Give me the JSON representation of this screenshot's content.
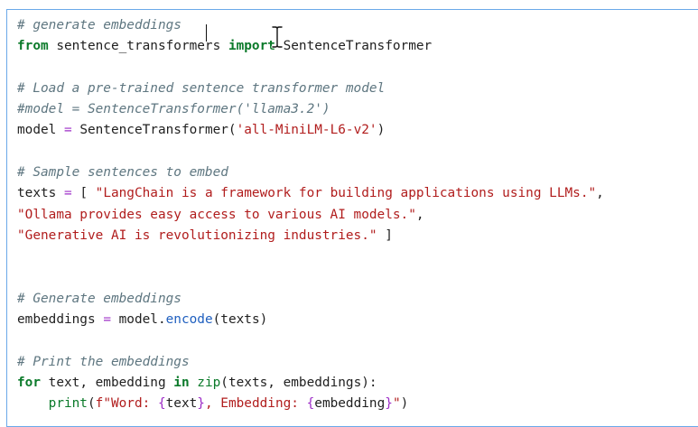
{
  "editor": {
    "lines": [
      {
        "tokens": [
          {
            "t": "c",
            "v": "# generate embeddings"
          }
        ]
      },
      {
        "tokens": [
          {
            "t": "k",
            "v": "from"
          },
          {
            "t": "p",
            "v": " sentence_transformers "
          },
          {
            "t": "k",
            "v": "import"
          },
          {
            "t": "p",
            "v": " SentenceTransformer"
          }
        ]
      },
      {
        "tokens": []
      },
      {
        "tokens": [
          {
            "t": "c",
            "v": "# Load a pre-trained sentence transformer model"
          }
        ]
      },
      {
        "tokens": [
          {
            "t": "c",
            "v": "#model = SentenceTransformer('llama3.2')"
          }
        ]
      },
      {
        "tokens": [
          {
            "t": "p",
            "v": "model "
          },
          {
            "t": "o",
            "v": "="
          },
          {
            "t": "p",
            "v": " SentenceTransformer("
          },
          {
            "t": "s",
            "v": "'all-MiniLM-L6-v2'"
          },
          {
            "t": "p",
            "v": ")"
          }
        ]
      },
      {
        "tokens": []
      },
      {
        "tokens": [
          {
            "t": "c",
            "v": "# Sample sentences to embed"
          }
        ]
      },
      {
        "tokens": [
          {
            "t": "p",
            "v": "texts "
          },
          {
            "t": "o",
            "v": "="
          },
          {
            "t": "p",
            "v": " [ "
          },
          {
            "t": "s",
            "v": "\"LangChain is a framework for building applications using LLMs.\""
          },
          {
            "t": "p",
            "v": ","
          }
        ]
      },
      {
        "tokens": [
          {
            "t": "s",
            "v": "\"Ollama provides easy access to various AI models.\""
          },
          {
            "t": "p",
            "v": ","
          }
        ]
      },
      {
        "tokens": [
          {
            "t": "s",
            "v": "\"Generative AI is revolutionizing industries.\""
          },
          {
            "t": "p",
            "v": " ]"
          }
        ]
      },
      {
        "tokens": []
      },
      {
        "tokens": []
      },
      {
        "tokens": [
          {
            "t": "c",
            "v": "# Generate embeddings"
          }
        ]
      },
      {
        "tokens": [
          {
            "t": "p",
            "v": "embeddings "
          },
          {
            "t": "o",
            "v": "="
          },
          {
            "t": "p",
            "v": " model."
          },
          {
            "t": "m",
            "v": "encode"
          },
          {
            "t": "p",
            "v": "(texts)"
          }
        ]
      },
      {
        "tokens": []
      },
      {
        "tokens": [
          {
            "t": "c",
            "v": "# Print the embeddings"
          }
        ]
      },
      {
        "tokens": [
          {
            "t": "k",
            "v": "for"
          },
          {
            "t": "p",
            "v": " text, embedding "
          },
          {
            "t": "k",
            "v": "in"
          },
          {
            "t": "p",
            "v": " "
          },
          {
            "t": "b",
            "v": "zip"
          },
          {
            "t": "p",
            "v": "(texts, embeddings):"
          }
        ]
      },
      {
        "tokens": [
          {
            "t": "p",
            "v": "    "
          },
          {
            "t": "b",
            "v": "print"
          },
          {
            "t": "p",
            "v": "("
          },
          {
            "t": "s",
            "v": "f\"Word: "
          },
          {
            "t": "o",
            "v": "{"
          },
          {
            "t": "p",
            "v": "text"
          },
          {
            "t": "o",
            "v": "}"
          },
          {
            "t": "s",
            "v": ", Embedding: "
          },
          {
            "t": "o",
            "v": "{"
          },
          {
            "t": "p",
            "v": "embedding"
          },
          {
            "t": "o",
            "v": "}"
          },
          {
            "t": "s",
            "v": "\""
          },
          {
            "t": "p",
            "v": ")"
          }
        ]
      }
    ]
  },
  "colors": {
    "comment": "#5e7680",
    "keyword": "#0b7a2a",
    "string": "#b11d1d",
    "operator": "#9d2cc7",
    "method": "#1f5fbf",
    "cell_border": "#6aa9e9"
  },
  "icons": {
    "text_cursor": "i-beam-cursor-icon",
    "caret": "text-caret"
  }
}
